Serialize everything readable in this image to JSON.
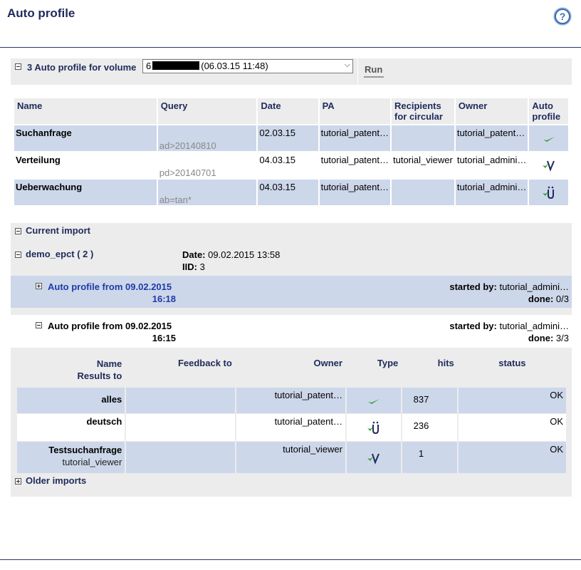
{
  "header": {
    "title": "Auto profile",
    "help_icon": "help-icon"
  },
  "volume": {
    "label": "3 Auto profile for volume",
    "select_prefix": "6",
    "select_suffix": "(06.03.15 11:48)",
    "run_label": "Run"
  },
  "profiles": {
    "columns": [
      "Name",
      "Query",
      "Date",
      "PA",
      "Recipients for circular",
      "Owner",
      "Auto profile"
    ],
    "rows": [
      {
        "name": "Suchanfrage",
        "query": "ad>20140810",
        "date": "02.03.15",
        "pa": "tutorial_patent…",
        "recipients": "",
        "owner": "tutorial_patent…",
        "auto_icon": "check-icon"
      },
      {
        "name": "Verteilung",
        "query": "pd>20140701",
        "date": "04.03.15",
        "pa": "tutorial_patent…",
        "recipients": "tutorial_viewer",
        "owner": "tutorial_admini…",
        "auto_icon": "check-v-icon"
      },
      {
        "name": "Ueberwachung",
        "query": "ab=tan*",
        "date": "04.03.15",
        "pa": "tutorial_patent…",
        "recipients": "",
        "owner": "tutorial_admini…",
        "auto_icon": "check-u-icon"
      }
    ]
  },
  "current_import": {
    "label": "Current import",
    "dataset": "demo_epct ( 2 )",
    "date_label": "Date:",
    "date_value": "09.02.2015 13:58",
    "iid_label": "IID:",
    "iid_value": "3",
    "runs": [
      {
        "title_line1": "Auto profile from 09.02.2015",
        "title_line2": "16:18",
        "started_label": "started by:",
        "started_value": "tutorial_admini…",
        "done_label": "done:",
        "done_value": "0/3"
      },
      {
        "title_line1": "Auto profile from 09.02.2015",
        "title_line2": "16:15",
        "started_label": "started by:",
        "started_value": "tutorial_admini…",
        "done_label": "done:",
        "done_value": "3/3"
      }
    ],
    "results": {
      "columns": {
        "name": "Name",
        "results_to": "Results to",
        "feedback": "Feedback to",
        "owner": "Owner",
        "type": "Type",
        "hits": "hits",
        "status": "status"
      },
      "rows": [
        {
          "name": "alles",
          "sub": "",
          "feedback": "",
          "owner": "tutorial_patent…",
          "type_icon": "check-icon",
          "hits": "837",
          "status": "OK"
        },
        {
          "name": "deutsch",
          "sub": "",
          "feedback": "",
          "owner": "tutorial_patent…",
          "type_icon": "check-u-icon",
          "hits": "236",
          "status": "OK"
        },
        {
          "name": "Testsuchanfrage",
          "sub": "tutorial_viewer",
          "feedback": "",
          "owner": "tutorial_viewer",
          "type_icon": "check-v-icon",
          "hits": "1",
          "status": "OK"
        }
      ]
    }
  },
  "older_imports": {
    "label": "Older imports"
  },
  "colors": {
    "navy": "#1f2a5c",
    "row_blue": "#cdd7ea",
    "panel_gray": "#ececec",
    "check_green": "#2aa32a"
  }
}
